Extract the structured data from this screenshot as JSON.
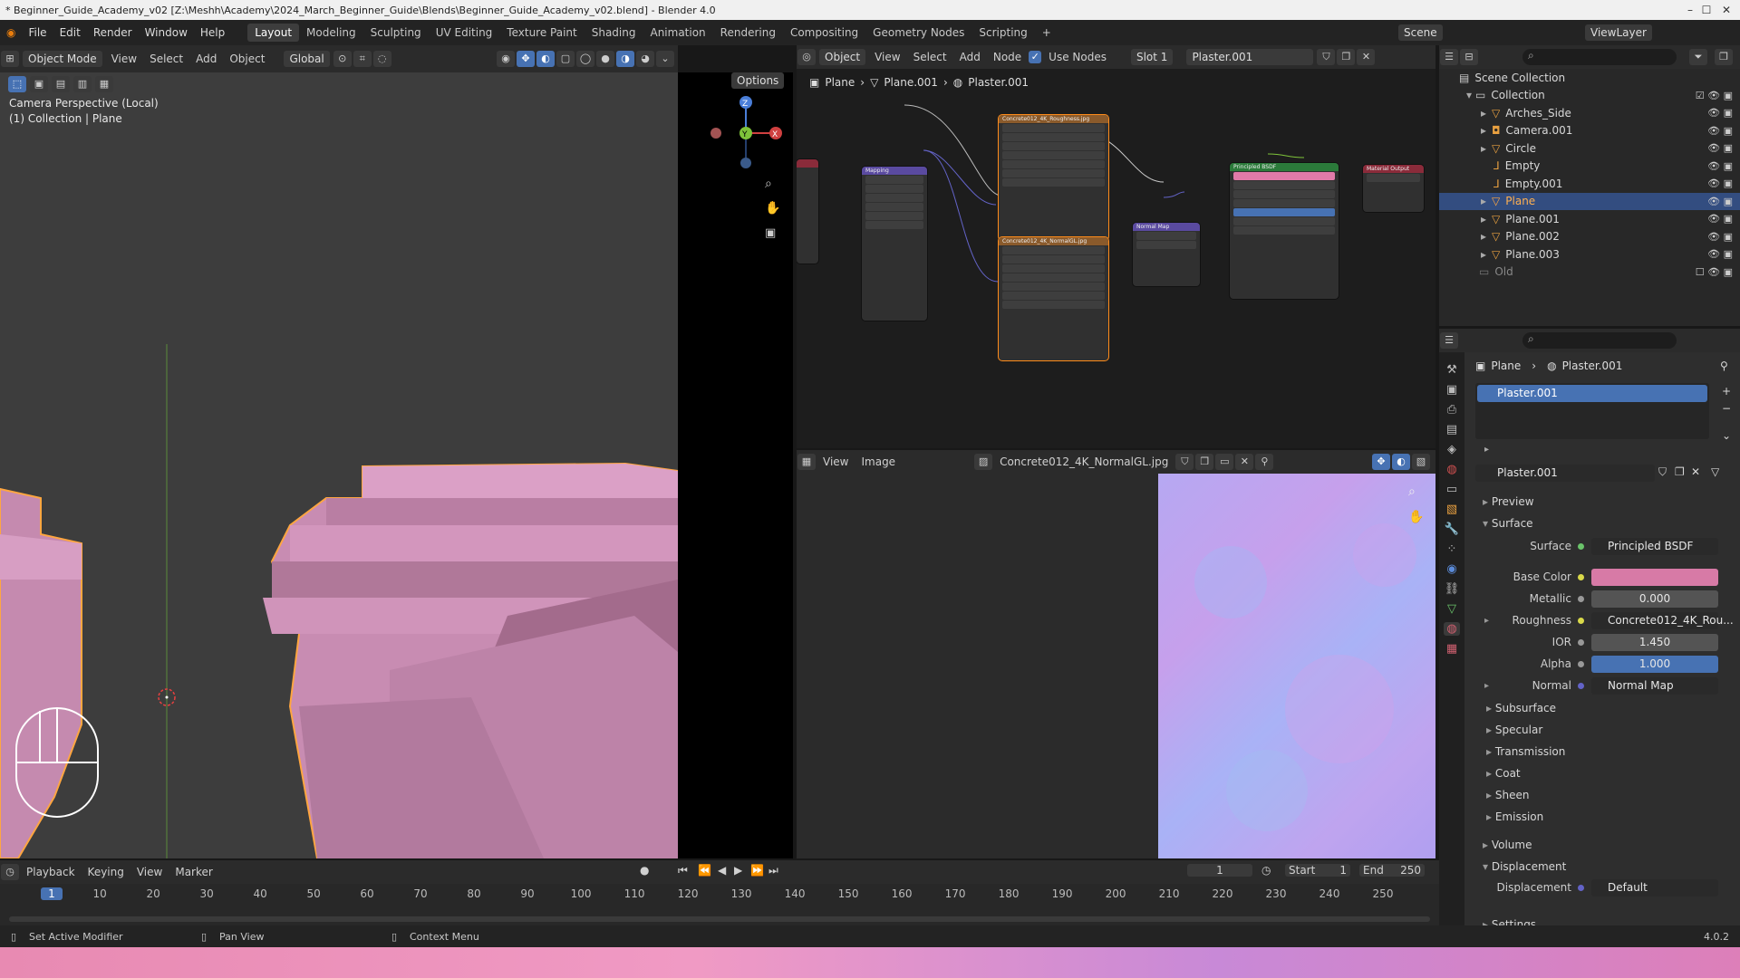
{
  "window": {
    "title": "* Beginner_Guide_Academy_v02 [Z:\\Meshh\\Academy\\2024_March_Beginner_Guide\\Blends\\Beginner_Guide_Academy_v02.blend] - Blender 4.0"
  },
  "menu": {
    "items": [
      "File",
      "Edit",
      "Render",
      "Window",
      "Help"
    ]
  },
  "workspaces": [
    "Layout",
    "Modeling",
    "Sculpting",
    "UV Editing",
    "Texture Paint",
    "Shading",
    "Animation",
    "Rendering",
    "Compositing",
    "Geometry Nodes",
    "Scripting"
  ],
  "active_workspace": "Layout",
  "scene": {
    "name": "Scene",
    "view_layer": "ViewLayer"
  },
  "viewport": {
    "mode": "Object Mode",
    "menus": [
      "View",
      "Select",
      "Add",
      "Object"
    ],
    "transform": "Global",
    "options": "Options",
    "overlay_line1": "Camera Perspective (Local)",
    "overlay_line2": "(1) Collection | Plane",
    "mesh_color": "#d99ac2"
  },
  "node_editor": {
    "type": "Object",
    "menus": [
      "View",
      "Select",
      "Add",
      "Node"
    ],
    "use_nodes": "Use Nodes",
    "slot": "Slot 1",
    "material": "Plaster.001",
    "breadcrumb": [
      "Plane",
      "Plane.001",
      "Plaster.001"
    ],
    "nodes": {
      "roughness_title": "Concrete012_4K_Roughness.jpg",
      "normal_title": "Concrete012_4K_NormalGL.jpg",
      "mapping_title": "Mapping",
      "normalmap_title": "Normal Map",
      "bsdf_title": "Principled BSDF",
      "output_title": "Material Output"
    }
  },
  "image_editor": {
    "menus": [
      "View",
      "Image"
    ],
    "image": "Concrete012_4K_NormalGL.jpg"
  },
  "outliner": {
    "root": "Scene Collection",
    "collection": "Collection",
    "items": [
      "Arches_Side",
      "Camera.001",
      "Circle",
      "Empty",
      "Empty.001",
      "Plane",
      "Plane.001",
      "Plane.002",
      "Plane.003"
    ],
    "selected": "Plane",
    "old": "Old"
  },
  "properties": {
    "breadcrumb": [
      "Plane",
      "Plaster.001"
    ],
    "slot_name": "Plaster.001",
    "material_name": "Plaster.001",
    "sections": {
      "preview": "Preview",
      "surface": "Surface",
      "volume": "Volume",
      "displacement": "Displacement",
      "settings": "Settings"
    },
    "fields": {
      "surface_label": "Surface",
      "surface_value": "Principled BSDF",
      "base_color_label": "Base Color",
      "base_color": "#d77aa6",
      "metallic_label": "Metallic",
      "metallic_value": "0.000",
      "roughness_label": "Roughness",
      "roughness_value": "Concrete012_4K_Rou...",
      "ior_label": "IOR",
      "ior_value": "1.450",
      "alpha_label": "Alpha",
      "alpha_value": "1.000",
      "normal_label": "Normal",
      "normal_value": "Normal Map",
      "displacement_label": "Displacement",
      "displacement_value": "Default"
    },
    "subpanels": [
      "Subsurface",
      "Specular",
      "Transmission",
      "Coat",
      "Sheen",
      "Emission"
    ]
  },
  "timeline": {
    "menus": [
      "Playback",
      "Keying",
      "View",
      "Marker"
    ],
    "current_frame": "1",
    "start_label": "Start",
    "start": "1",
    "end_label": "End",
    "end": "250",
    "ticks": [
      "1",
      "10",
      "20",
      "30",
      "40",
      "50",
      "60",
      "70",
      "80",
      "90",
      "100",
      "110",
      "120",
      "130",
      "140",
      "150",
      "160",
      "170",
      "180",
      "190",
      "200",
      "210",
      "220",
      "230",
      "240",
      "250"
    ]
  },
  "statusbar": {
    "left": "Set Active Modifier",
    "mid": "Pan View",
    "right": "Context Menu",
    "version": "4.0.2"
  }
}
